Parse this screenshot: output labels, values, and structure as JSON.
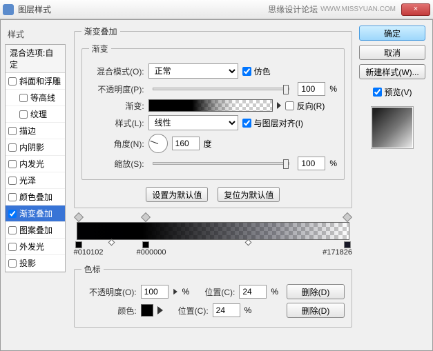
{
  "titlebar": {
    "title": "图层样式",
    "watermark1": "思缘设计论坛",
    "watermark2": "WWW.MISSYUAN.COM",
    "close": "×"
  },
  "sidebar": {
    "header": "样式",
    "blend_opts": "混合选项:自定",
    "items": [
      {
        "label": "斜面和浮雕",
        "checked": false
      },
      {
        "label": "等高线",
        "checked": false,
        "indent": true
      },
      {
        "label": "纹理",
        "checked": false,
        "indent": true
      },
      {
        "label": "描边",
        "checked": false
      },
      {
        "label": "内阴影",
        "checked": false
      },
      {
        "label": "内发光",
        "checked": false
      },
      {
        "label": "光泽",
        "checked": false
      },
      {
        "label": "颜色叠加",
        "checked": false
      },
      {
        "label": "渐变叠加",
        "checked": true,
        "selected": true
      },
      {
        "label": "图案叠加",
        "checked": false
      },
      {
        "label": "外发光",
        "checked": false
      },
      {
        "label": "投影",
        "checked": false
      }
    ]
  },
  "overlay": {
    "group_title": "渐变叠加",
    "sub_title": "渐变",
    "blend_label": "混合模式(O):",
    "blend_value": "正常",
    "dither_label": "仿色",
    "opacity_label": "不透明度(P):",
    "opacity_value": "100",
    "percent": "%",
    "gradient_label": "渐变:",
    "reverse_label": "反向(R)",
    "style_label": "样式(L):",
    "style_value": "线性",
    "align_label": "与图层对齐(I)",
    "angle_label": "角度(N):",
    "angle_value": "160",
    "degree": "度",
    "scale_label": "缩放(S):",
    "scale_value": "100",
    "set_default": "设置为默认值",
    "reset_default": "复位为默认值"
  },
  "stops": {
    "left_hex": "#010102",
    "mid_hex": "#000000",
    "right_hex": "#171826",
    "fieldset": "色标",
    "opacity_label": "不透明度(O):",
    "opacity_value": "100",
    "arrow": "▸",
    "pct": "%",
    "pos_label": "位置(C):",
    "pos1_value": "24",
    "pos2_value": "24",
    "color_label": "颜色:",
    "delete": "删除(D)"
  },
  "right": {
    "ok": "确定",
    "cancel": "取消",
    "new_style": "新建样式(W)...",
    "preview": "预览(V)"
  }
}
